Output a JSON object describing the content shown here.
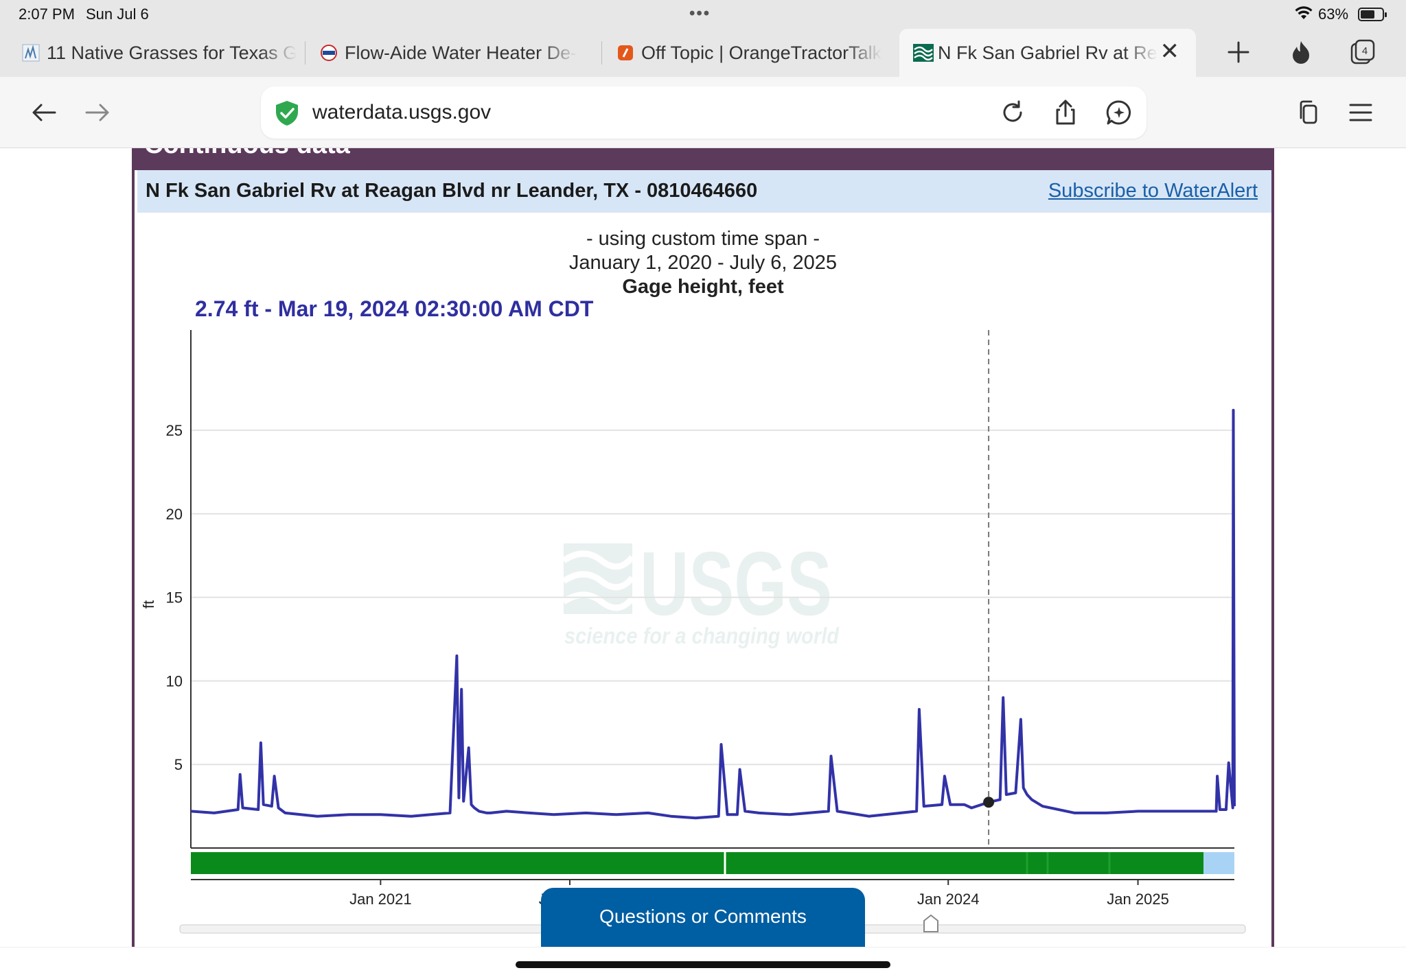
{
  "status_bar": {
    "time": "2:07 PM",
    "date": "Sun Jul 6",
    "battery": "63%",
    "battery_level": 0.63
  },
  "tabs": [
    {
      "title": "11 Native Grasses for Texas G",
      "active": false
    },
    {
      "title": "Flow-Aide Water Heater De-",
      "active": false
    },
    {
      "title": "Off Topic | OrangeTractorTalk",
      "active": false
    },
    {
      "title": "N Fk San Gabriel Rv at Re",
      "active": true
    }
  ],
  "tab_count": "4",
  "address_bar": {
    "url": "waterdata.usgs.gov"
  },
  "page": {
    "section_header": "Continuous data",
    "site_title": "N Fk San Gabriel Rv at Reagan Blvd nr Leander, TX - 0810464660",
    "subscribe_link": "Subscribe to WaterAlert",
    "caption_line1": "- using custom time span -",
    "caption_line2": "January 1, 2020 - July 6, 2025",
    "caption_line3": "Gage height, feet",
    "readout": "2.74 ft - Mar 19, 2024 02:30:00 AM CDT",
    "questions_button": "Questions or Comments",
    "watermark": {
      "logo": "USGS",
      "tagline": "science for a changing world"
    }
  },
  "chart_data": {
    "type": "line",
    "title": "Gage height, feet",
    "ylabel": "ft",
    "xlabel": "",
    "x_ticks": [
      "Jan 2021",
      "Jan 2022",
      "Jan 2024",
      "Jan 2025"
    ],
    "y_ticks": [
      5,
      10,
      15,
      20,
      25
    ],
    "xlim": [
      "2020-01-01",
      "2025-07-06"
    ],
    "ylim": [
      0,
      31
    ],
    "grid": true,
    "series_color": "#3232a8",
    "cursor": {
      "date": "2024-03-19",
      "value": 2.74
    },
    "series": [
      {
        "x": [
          "2020-01-01",
          "2020-02-15",
          "2020-04-01",
          "2020-04-05",
          "2020-04-10",
          "2020-05-10",
          "2020-05-15",
          "2020-05-20",
          "2020-06-05",
          "2020-06-10",
          "2020-06-18",
          "2020-07-01",
          "2020-09-01",
          "2020-11-01",
          "2021-01-01",
          "2021-03-01",
          "2021-05-15",
          "2021-05-28",
          "2021-06-01",
          "2021-06-06",
          "2021-06-10",
          "2021-06-20",
          "2021-06-25",
          "2021-07-01",
          "2021-07-10",
          "2021-07-25",
          "2021-08-01",
          "2021-09-01",
          "2021-10-15",
          "2021-12-01",
          "2022-02-01",
          "2022-04-01",
          "2022-06-01",
          "2022-07-15",
          "2022-09-01",
          "2022-10-15",
          "2022-10-20",
          "2022-11-01",
          "2022-11-20",
          "2022-11-25",
          "2022-12-05",
          "2023-01-01",
          "2023-03-01",
          "2023-05-15",
          "2023-05-20",
          "2023-06-01",
          "2023-08-01",
          "2023-10-01",
          "2023-11-01",
          "2023-11-06",
          "2023-11-15",
          "2023-12-20",
          "2023-12-25",
          "2024-01-05",
          "2024-02-01",
          "2024-02-15",
          "2024-03-19",
          "2024-04-10",
          "2024-04-16",
          "2024-04-22",
          "2024-05-10",
          "2024-05-20",
          "2024-05-25",
          "2024-06-01",
          "2024-06-10",
          "2024-07-01",
          "2024-09-01",
          "2024-11-01",
          "2025-01-01",
          "2025-03-01",
          "2025-05-01",
          "2025-06-01",
          "2025-06-03",
          "2025-06-08",
          "2025-06-20",
          "2025-06-25",
          "2025-07-03",
          "2025-07-04",
          "2025-07-06"
        ],
        "y": [
          2.2,
          2.1,
          2.3,
          4.4,
          2.4,
          2.3,
          6.3,
          2.6,
          2.5,
          4.3,
          2.4,
          2.1,
          1.9,
          2.0,
          2.0,
          1.9,
          2.1,
          11.5,
          3.0,
          9.5,
          2.8,
          6.0,
          2.6,
          2.4,
          2.2,
          2.1,
          2.1,
          2.2,
          2.1,
          2.0,
          2.1,
          2.0,
          2.1,
          1.9,
          1.8,
          1.9,
          6.2,
          2.0,
          2.0,
          4.7,
          2.2,
          2.1,
          2.0,
          2.2,
          5.5,
          2.2,
          1.9,
          2.1,
          2.2,
          8.3,
          2.5,
          2.6,
          4.3,
          2.6,
          2.6,
          2.4,
          2.74,
          2.9,
          9.0,
          3.2,
          3.3,
          7.7,
          3.6,
          3.2,
          2.9,
          2.5,
          2.1,
          2.1,
          2.2,
          2.2,
          2.2,
          2.2,
          4.3,
          2.3,
          2.3,
          5.1,
          2.4,
          26.2,
          2.5
        ]
      }
    ]
  }
}
